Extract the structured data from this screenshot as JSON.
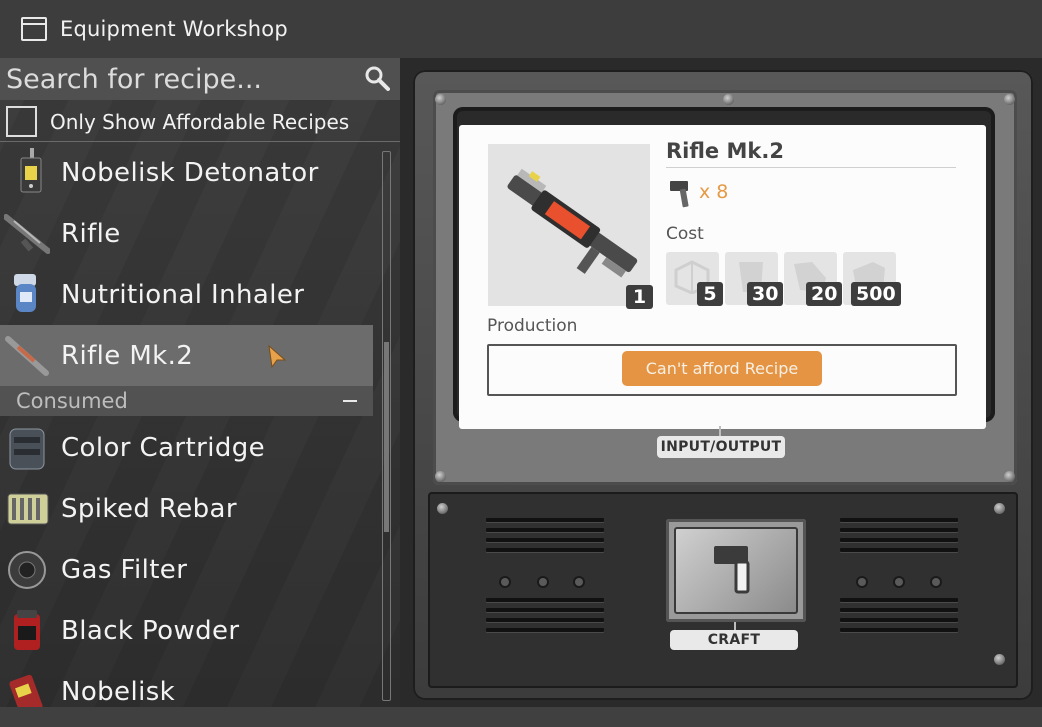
{
  "window": {
    "title": "Equipment Workshop"
  },
  "search": {
    "placeholder": "Search for recipe..."
  },
  "filter": {
    "label": "Only Show Affordable Recipes",
    "checked": false
  },
  "recipes": [
    {
      "label": "Nobelisk Detonator",
      "icon": "detonator-icon"
    },
    {
      "label": "Rifle",
      "icon": "rifle-icon"
    },
    {
      "label": "Nutritional Inhaler",
      "icon": "inhaler-icon"
    },
    {
      "label": "Rifle Mk.2",
      "icon": "rifle-mk2-icon",
      "selected": true
    }
  ],
  "category": {
    "label": "Consumed",
    "toggle": "collapse"
  },
  "consumed_items": [
    {
      "label": "Color Cartridge",
      "icon": "cartridge-icon"
    },
    {
      "label": "Spiked Rebar",
      "icon": "rebar-icon"
    },
    {
      "label": "Gas Filter",
      "icon": "gas-filter-icon"
    },
    {
      "label": "Black Powder",
      "icon": "black-powder-icon"
    },
    {
      "label": "Nobelisk",
      "icon": "nobelisk-icon"
    }
  ],
  "detail": {
    "name": "Rifle Mk.2",
    "product_quantity": "1",
    "craft_clicks": "x 8",
    "cost_label": "Cost",
    "costs": [
      {
        "quantity": "5",
        "icon": "cube-frame-icon"
      },
      {
        "quantity": "30",
        "icon": "plate-icon"
      },
      {
        "quantity": "20",
        "icon": "ingot-icon"
      },
      {
        "quantity": "500",
        "icon": "ore-icon"
      }
    ],
    "production_label": "Production",
    "afford_button": "Can't afford Recipe"
  },
  "machine": {
    "io_label": "INPUT/OUTPUT",
    "craft_label": "CRAFT"
  },
  "colors": {
    "accent": "#e49443",
    "selected_row": "#6c6c6c"
  }
}
